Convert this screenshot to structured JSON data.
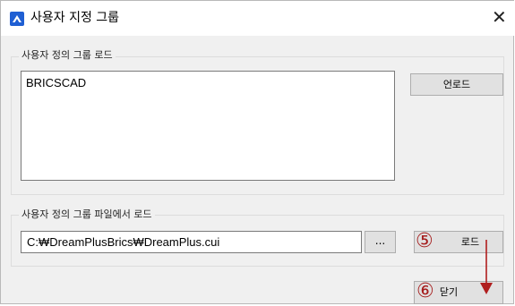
{
  "window": {
    "title": "사용자 지정 그룹",
    "close_glyph": "✕"
  },
  "load_group": {
    "legend": "사용자 정의 그룹 로드",
    "items": [
      "BRICSCAD"
    ],
    "unload_label": "언로드"
  },
  "load_file": {
    "legend": "사용자 정의 그룹 파일에서 로드",
    "path_value": "C:₩DreamPlusBrics₩DreamPlus.cui",
    "browse_label": "...",
    "load_label": "로드"
  },
  "close_label": "닫기",
  "annotations": {
    "step5": "⑤",
    "step6": "⑥",
    "color": "#b01e1e"
  }
}
